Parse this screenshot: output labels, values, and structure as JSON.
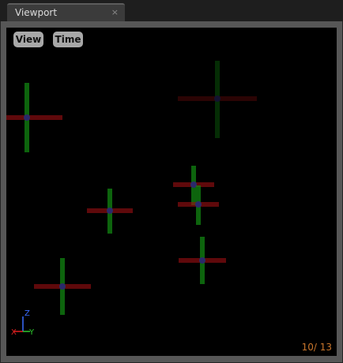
{
  "tab": {
    "label": "Viewport",
    "close_glyph": "×"
  },
  "viewport": {
    "view_label": "View",
    "time_label": "Time",
    "frame_counter": "10/  13",
    "axes": {
      "x": "X",
      "y": "Y",
      "z": "Z"
    }
  },
  "colors": {
    "frame_counter": "#c9762c",
    "axis_x": "#e02020",
    "axis_y": "#2dc92d",
    "axis_z": "#3a6cff"
  }
}
